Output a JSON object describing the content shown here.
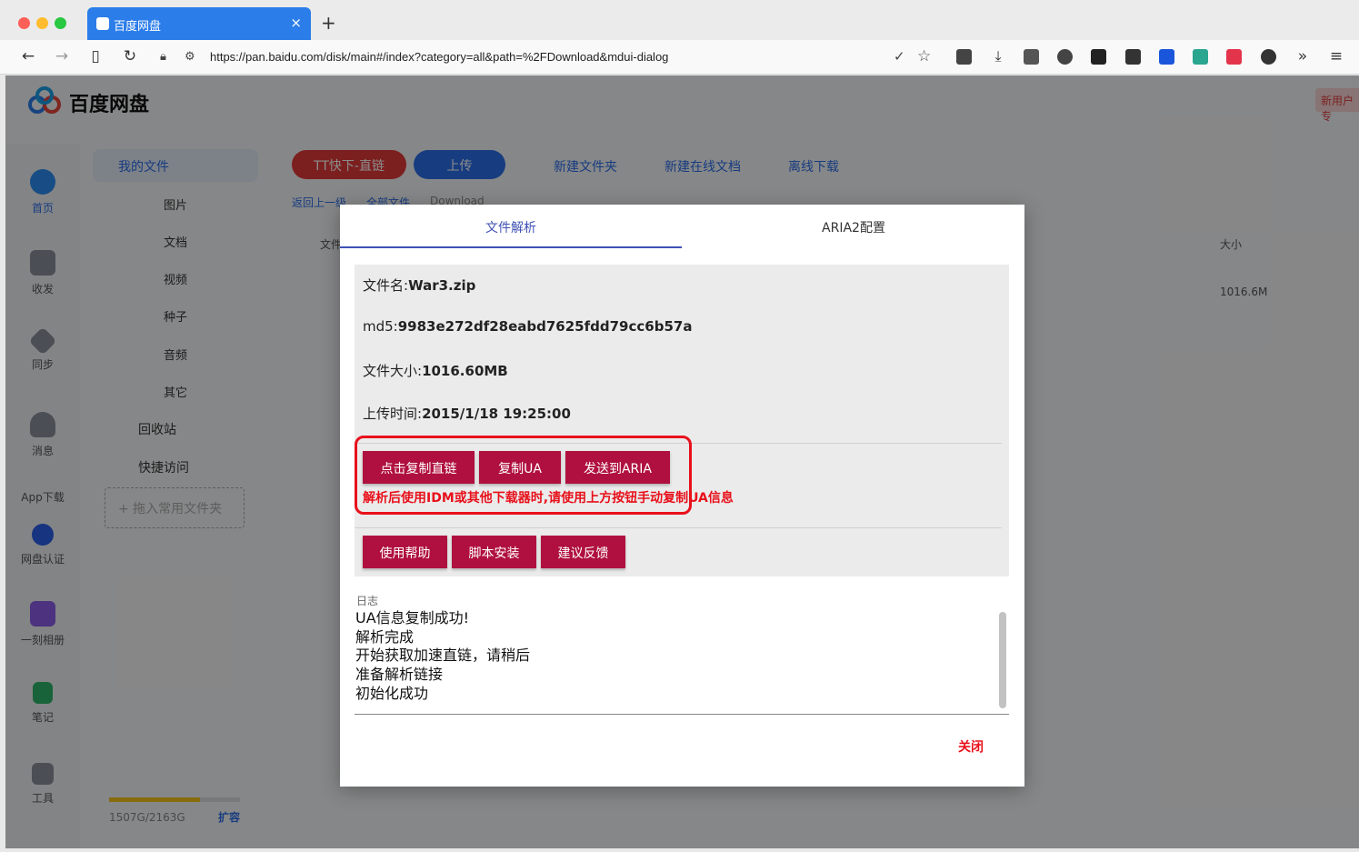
{
  "browser": {
    "tab_title": "百度网盘",
    "tab_close": "×",
    "new_tab": "+",
    "url": "https://pan.baidu.com/disk/main#/index?category=all&path=%2FDownload&mdui-dialog"
  },
  "app": {
    "logo_text": "百度网盘",
    "new_user_badge": "新用户专"
  },
  "rail": [
    {
      "label": "首页"
    },
    {
      "label": "收发"
    },
    {
      "label": "同步"
    },
    {
      "label": "消息"
    },
    {
      "label": "App下载"
    },
    {
      "label": "网盘认证"
    },
    {
      "label": "一刻相册"
    },
    {
      "label": "笔记"
    },
    {
      "label": "工具"
    }
  ],
  "sidebar": {
    "my_files": "我的文件",
    "items": [
      "图片",
      "文档",
      "视频",
      "种子",
      "音频",
      "其它"
    ],
    "recycle": "回收站",
    "quick_access": "快捷访问",
    "drag_hint": "+ 拖入常用文件夹",
    "storage": "1507G/2163G",
    "expand": "扩容",
    "storage_used_fraction": 0.697
  },
  "toolbar": {
    "tt_download": "TT快下-直链",
    "upload": "上传",
    "new_folder": "新建文件夹",
    "new_doc": "新建在线文档",
    "offline": "离线下载"
  },
  "breadcrumb": {
    "back": "返回上一级",
    "all": "全部文件",
    "current": "Download"
  },
  "filelist": {
    "col_name": "文件",
    "col_size": "大小",
    "row_size": "1016.6M"
  },
  "dialog": {
    "tab_parse": "文件解析",
    "tab_aria": "ARIA2配置",
    "filename_label": "文件名:",
    "filename": "War3.zip",
    "md5_label": "md5:",
    "md5": "9983e272df28eabd7625fdd79cc6b57a",
    "size_label": "文件大小:",
    "size": "1016.60MB",
    "upload_label": "上传时间:",
    "upload_time": "2015/1/18 19:25:00",
    "btn_copy_link": "点击复制直链",
    "btn_copy_ua": "复制UA",
    "btn_send_aria": "发送到ARIA",
    "warning": "解析后使用IDM或其他下载器时,请使用上方按钮手动复制UA信息",
    "btn_help": "使用帮助",
    "btn_install": "脚本安装",
    "btn_feedback": "建议反馈",
    "log_label": "日志",
    "log": [
      "UA信息复制成功!",
      "解析完成",
      "开始获取加速直链，请稍后",
      "准备解析链接",
      "初始化成功"
    ],
    "close": "关闭"
  },
  "colors": {
    "accent_blue": "#3f51b5",
    "button_red": "#b0103f",
    "warning_red": "#e8101b",
    "tab_blue": "#2b7de9"
  }
}
